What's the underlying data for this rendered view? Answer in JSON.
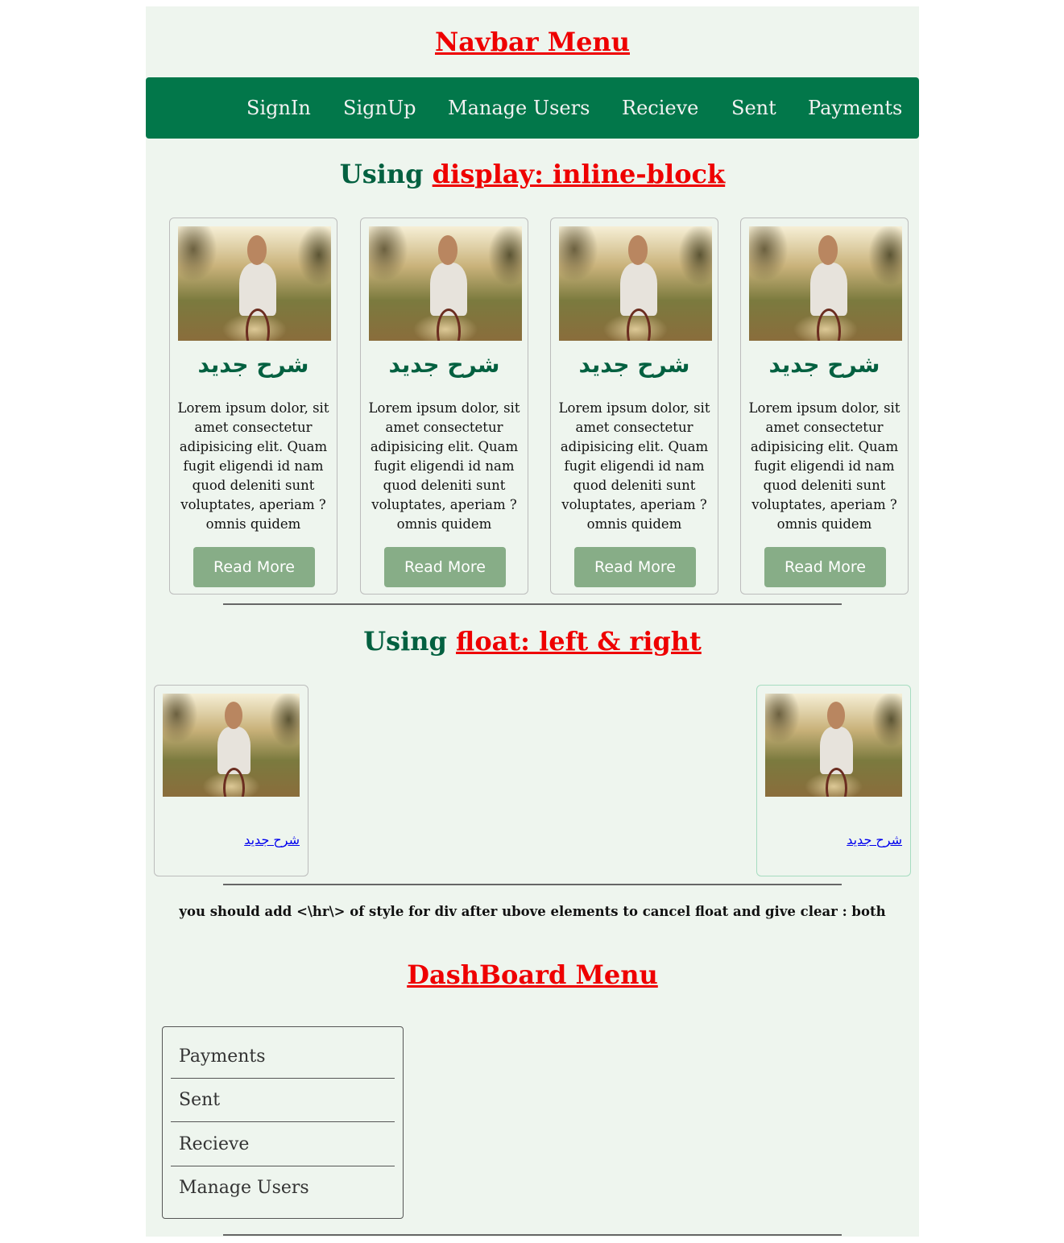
{
  "navbar_section": {
    "title": "Navbar Menu"
  },
  "navbar": {
    "items": [
      "SignIn",
      "SignUp",
      "Manage Users",
      "Recieve",
      "Sent",
      "Payments"
    ]
  },
  "inline_section": {
    "prefix": "Using",
    "link": "display: inline-block"
  },
  "cards": [
    {
      "title": "شرح جديد",
      "text": "Lorem ipsum dolor, sit amet consectetur adipisicing elit. Quam fugit eligendi id nam quod deleniti sunt voluptates, aperiam ?omnis quidem",
      "button": "Read More"
    },
    {
      "title": "شرح جديد",
      "text": "Lorem ipsum dolor, sit amet consectetur adipisicing elit. Quam fugit eligendi id nam quod deleniti sunt voluptates, aperiam ?omnis quidem",
      "button": "Read More"
    },
    {
      "title": "شرح جديد",
      "text": "Lorem ipsum dolor, sit amet consectetur adipisicing elit. Quam fugit eligendi id nam quod deleniti sunt voluptates, aperiam ?omnis quidem",
      "button": "Read More"
    },
    {
      "title": "شرح جديد",
      "text": "Lorem ipsum dolor, sit amet consectetur adipisicing elit. Quam fugit eligendi id nam quod deleniti sunt voluptates, aperiam ?omnis quidem",
      "button": "Read More"
    }
  ],
  "float_section": {
    "prefix": "Using",
    "link": "float: left & right"
  },
  "float_cards": [
    {
      "link": "شرح جديد"
    },
    {
      "link": "شرح جديد"
    }
  ],
  "note": "you should add <\\hr\\> of style for div after ubove elements to cancel float and give clear : both",
  "dashboard_section": {
    "title": "DashBoard Menu"
  },
  "dashboard": {
    "items": [
      "Payments",
      "Sent",
      "Recieve",
      "Manage Users"
    ]
  },
  "colors": {
    "page_bg": "#eef5ee",
    "navbar_bg": "#02774a",
    "heading_green": "#036040",
    "link_red": "#ee0000",
    "button_bg": "#87ad87"
  }
}
